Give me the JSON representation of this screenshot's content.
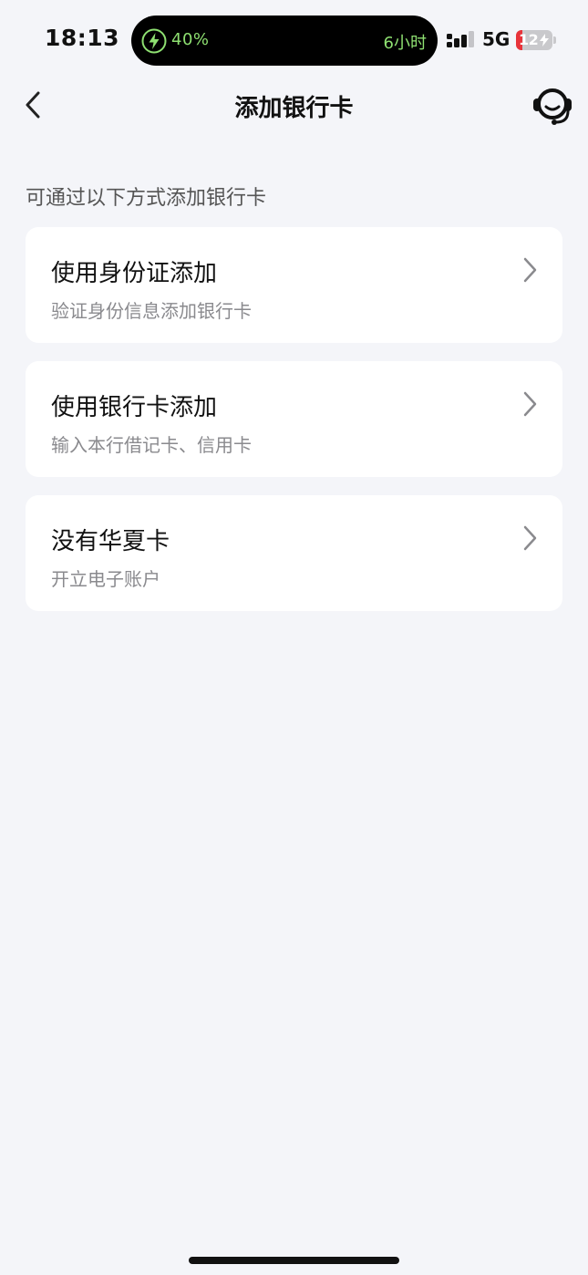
{
  "status_bar": {
    "time": "18:13",
    "island": {
      "charge_percent": "40%",
      "remaining_time": "6小时",
      "icon": "charging-bolt-icon",
      "accent_color": "#8ee071"
    },
    "network": "5G",
    "signal_icon": "signal-bars-icon",
    "battery": {
      "level_text": "12",
      "level_percent": 12,
      "charging": true,
      "low_color": "#e8333a"
    }
  },
  "nav": {
    "back_icon": "chevron-left-icon",
    "title": "添加银行卡",
    "service_icon": "headset-icon"
  },
  "content": {
    "hint": "可通过以下方式添加银行卡",
    "options": [
      {
        "title": "使用身份证添加",
        "desc": "验证身份信息添加银行卡",
        "icon": "chevron-right-icon"
      },
      {
        "title": "使用银行卡添加",
        "desc": "输入本行借记卡、信用卡",
        "icon": "chevron-right-icon"
      },
      {
        "title": "没有华夏卡",
        "desc": "开立电子账户",
        "icon": "chevron-right-icon"
      }
    ]
  },
  "colors": {
    "background": "#f4f5f9",
    "card": "#ffffff",
    "text_primary": "#111111",
    "text_secondary": "#8a8a8e"
  }
}
